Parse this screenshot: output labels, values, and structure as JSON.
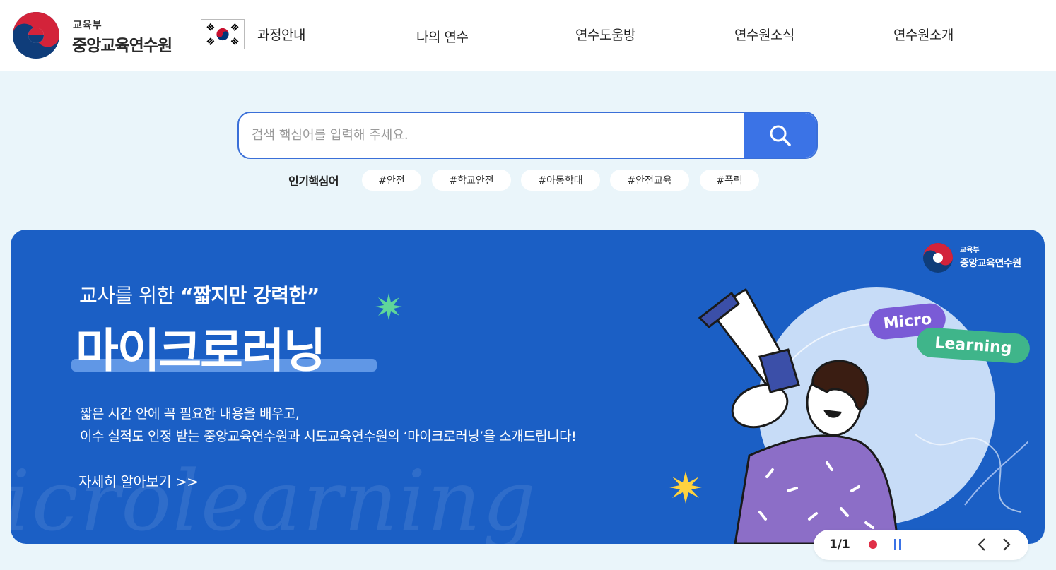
{
  "header": {
    "org_small": "교육부",
    "org_name": "중앙교육연수원",
    "nav": [
      "과정안내",
      "나의 연수",
      "연수도움방",
      "연수원소식",
      "연수원소개"
    ]
  },
  "search": {
    "placeholder": "검색 핵심어를 입력해 주세요.",
    "value": ""
  },
  "keywords": {
    "label": "인기핵심어",
    "tags": [
      "#안전",
      "#학교안전",
      "#아동학대",
      "#안전교육",
      "#폭력"
    ]
  },
  "banner": {
    "subtitle_prefix": "교사를 위한 ",
    "subtitle_emphasis": "“짧지만 강력한”",
    "title": "마이크로러닝",
    "desc_line1": "짧은 시간 안에 꼭 필요한 내용을 배우고,",
    "desc_line2": "이수 실적도 인정 받는 중앙교육연수원과 시도교육연수원의 ‘마이크로러닝’을 소개드립니다!",
    "more_label": "자세히 알아보기  >>",
    "bg_text": "icrolearning",
    "logo_small": "교육부",
    "logo_name": "중앙교육연수원",
    "pill_micro": "Micro",
    "pill_learning": "Learning"
  },
  "slider": {
    "current": 1,
    "total": 1,
    "count_label": "1/1"
  },
  "colors": {
    "banner_bg": "#1b5fc5",
    "search_accent": "#3b73e6",
    "active_dot": "#e02f47",
    "page_bg": "#eaf5fa"
  },
  "icons": {
    "logo": "mest-emblem-icon",
    "flag": "korea-flag-icon",
    "search": "search-icon",
    "pause": "pause-icon",
    "prev": "chevron-left-icon",
    "next": "chevron-right-icon"
  }
}
